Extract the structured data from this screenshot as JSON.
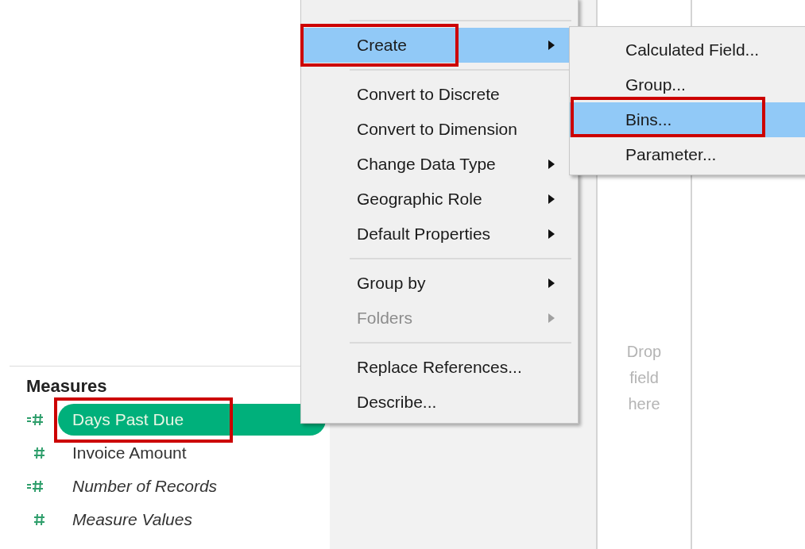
{
  "measures": {
    "title": "Measures",
    "fields": [
      {
        "label": "Days Past Due",
        "kind": "calculated",
        "italic": false,
        "selected": true,
        "highlighted": true
      },
      {
        "label": "Invoice Amount",
        "kind": "plain",
        "italic": false,
        "selected": false,
        "highlighted": false
      },
      {
        "label": "Number of Records",
        "kind": "calculated",
        "italic": true,
        "selected": false,
        "highlighted": false
      },
      {
        "label": "Measure Values",
        "kind": "plain",
        "italic": true,
        "selected": false,
        "highlighted": false
      }
    ]
  },
  "drop_zone": {
    "text": "Drop field here"
  },
  "context_menu": {
    "items": [
      {
        "kind": "separator"
      },
      {
        "kind": "item",
        "label": "Create",
        "submenu": true,
        "selected": true,
        "disabled": false,
        "highlighted": true
      },
      {
        "kind": "separator"
      },
      {
        "kind": "item",
        "label": "Convert to Discrete",
        "submenu": false,
        "selected": false,
        "disabled": false,
        "highlighted": false
      },
      {
        "kind": "item",
        "label": "Convert to Dimension",
        "submenu": false,
        "selected": false,
        "disabled": false,
        "highlighted": false
      },
      {
        "kind": "item",
        "label": "Change Data Type",
        "submenu": true,
        "selected": false,
        "disabled": false,
        "highlighted": false
      },
      {
        "kind": "item",
        "label": "Geographic Role",
        "submenu": true,
        "selected": false,
        "disabled": false,
        "highlighted": false
      },
      {
        "kind": "item",
        "label": "Default Properties",
        "submenu": true,
        "selected": false,
        "disabled": false,
        "highlighted": false
      },
      {
        "kind": "separator"
      },
      {
        "kind": "item",
        "label": "Group by",
        "submenu": true,
        "selected": false,
        "disabled": false,
        "highlighted": false
      },
      {
        "kind": "item",
        "label": "Folders",
        "submenu": true,
        "selected": false,
        "disabled": true,
        "highlighted": false
      },
      {
        "kind": "separator"
      },
      {
        "kind": "item",
        "label": "Replace References...",
        "submenu": false,
        "selected": false,
        "disabled": false,
        "highlighted": false
      },
      {
        "kind": "item",
        "label": "Describe...",
        "submenu": false,
        "selected": false,
        "disabled": false,
        "highlighted": false
      }
    ]
  },
  "submenu": {
    "items": [
      {
        "label": "Calculated Field...",
        "selected": false,
        "highlighted": false
      },
      {
        "label": "Group...",
        "selected": false,
        "highlighted": false
      },
      {
        "label": "Bins...",
        "selected": true,
        "highlighted": true
      },
      {
        "label": "Parameter...",
        "selected": false,
        "highlighted": false
      }
    ]
  }
}
